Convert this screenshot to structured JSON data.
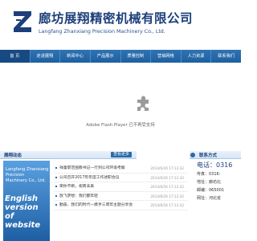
{
  "header": {
    "company_cn": "廊坊展翔精密机械有限公司",
    "company_en": "Langfang Zhanxiang Precision Machinery  Co., Ltd.",
    "brand_color": "#1c3f7a"
  },
  "nav": {
    "items": [
      "首  页",
      "走进展翔",
      "新闻中心",
      "产品展示",
      "质量控制",
      "营销网络",
      "人力资源",
      "联系我们"
    ]
  },
  "banner": {
    "plugin_icon": "puzzle-piece-icon",
    "plugin_message": "Adobe Flash Player 已不再受支持"
  },
  "news_section": {
    "title": "展翔动态",
    "more_label": "查看更多",
    "items": [
      {
        "title": "祥童职范围教书记—行到公司环境考察",
        "date": "2014/6/26 17:12:32"
      },
      {
        "title": "公司召开2017年年度工作述职会议",
        "date": "2014/6/26 17:12:32"
      },
      {
        "title": "荣你不断，祝商未来",
        "date": "2014/6/26 17:12:32"
      },
      {
        "title": "放飞梦想：我们都年轻",
        "date": "2014/6/26 17:12:32"
      },
      {
        "title": "勤奋，我们的时代—携手三周年主题分享会",
        "date": "2014/6/26 17:12:32"
      }
    ]
  },
  "promo": {
    "line1": "Langfang Zhanxiang Precision",
    "line2": "Machinery  Co., Ltd.",
    "big": "English version of website"
  },
  "contact": {
    "title": "联系方式",
    "phone": "电话：0316",
    "fax": "传真：0316-",
    "address": "地址：廊坊北",
    "zip": "邮编：065001",
    "web": "网址：河北省"
  }
}
